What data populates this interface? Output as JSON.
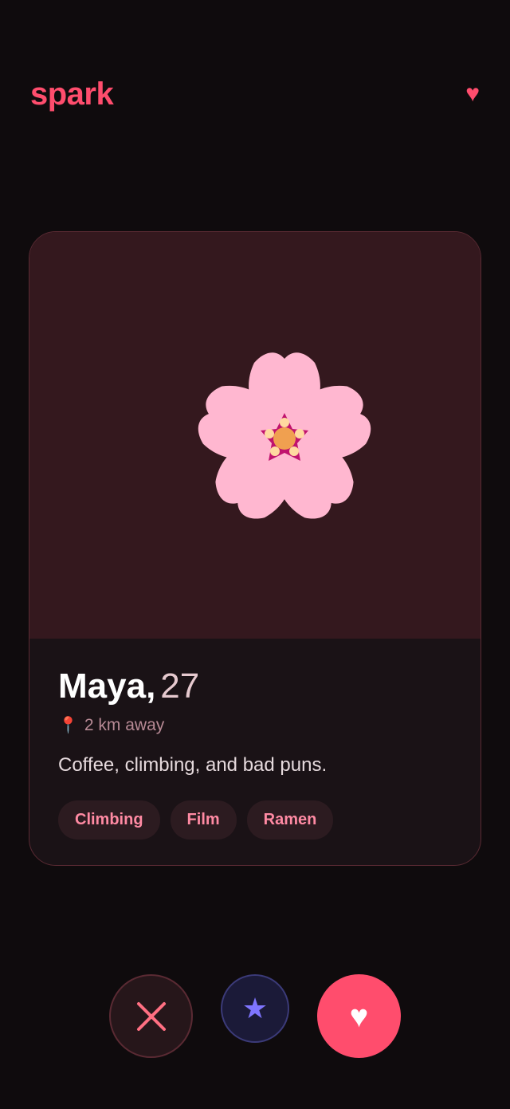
{
  "app": {
    "brand": "spark",
    "header_icon": "heart-icon"
  },
  "profile": {
    "photo_icon": "cherry-blossom",
    "name": "Maya,",
    "age": "27",
    "location_icon": "📍",
    "location": "2 km away",
    "bio": "Coffee, climbing, and bad puns.",
    "tags": [
      "Climbing",
      "Film",
      "Ramen"
    ]
  },
  "actions": {
    "nope_icon": "close-icon",
    "super_icon": "★",
    "like_icon": "♥"
  },
  "colors": {
    "accent": "#ff4d6d",
    "background": "#0f0b0d",
    "card": "#1a1216",
    "photo_bg": "#34181e",
    "super_like": "#7f75ff"
  }
}
